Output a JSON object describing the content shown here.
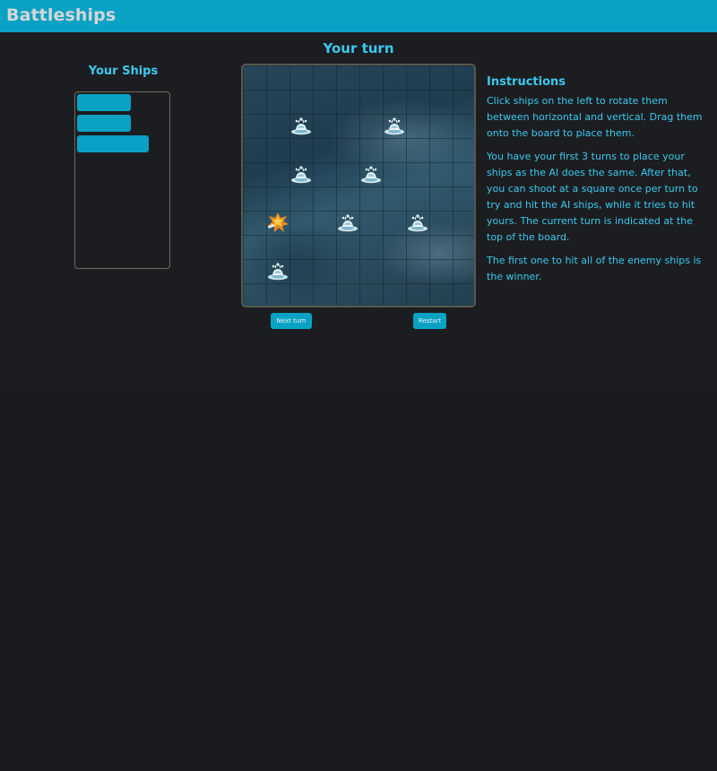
{
  "app": {
    "title": "Battleships"
  },
  "game": {
    "turn_status": "Your turn",
    "your_ships_title": "Your Ships",
    "ships": [
      {
        "orientation": "horizontal",
        "length": 3
      },
      {
        "orientation": "horizontal",
        "length": 3
      },
      {
        "orientation": "horizontal",
        "length": 4
      }
    ],
    "board": {
      "rows": 10,
      "cols": 10,
      "markers": [
        {
          "row": 2,
          "col": 2,
          "type": "miss",
          "icon": "splash-icon"
        },
        {
          "row": 2,
          "col": 6,
          "type": "miss",
          "icon": "splash-icon"
        },
        {
          "row": 4,
          "col": 2,
          "type": "miss",
          "icon": "splash-icon"
        },
        {
          "row": 4,
          "col": 5,
          "type": "miss",
          "icon": "splash-icon"
        },
        {
          "row": 6,
          "col": 1,
          "type": "hit",
          "icon": "explosion-icon"
        },
        {
          "row": 6,
          "col": 4,
          "type": "miss",
          "icon": "splash-icon"
        },
        {
          "row": 6,
          "col": 7,
          "type": "miss",
          "icon": "splash-icon"
        },
        {
          "row": 8,
          "col": 1,
          "type": "miss",
          "icon": "splash-icon"
        }
      ]
    },
    "buttons": {
      "next_turn": "Next turn",
      "restart": "Restart"
    }
  },
  "instructions": {
    "title": "Instructions",
    "paragraphs": [
      "Click ships on the left to rotate them between horizontal and vertical. Drag them onto the board to place them.",
      "You have your first 3 turns to place your ships as the AI does the same. After that, you can shoot at a square once per turn to try and hit the AI ships, while it tries to hit yours. The current turn is indicated at the top of the board.",
      "The first one to hit all of the enemy ships is the winner."
    ]
  },
  "colors": {
    "accent": "#0aa2c4",
    "text_accent": "#3cc8ee",
    "background": "#1a1b1e",
    "title_text": "#d4d6d8"
  }
}
